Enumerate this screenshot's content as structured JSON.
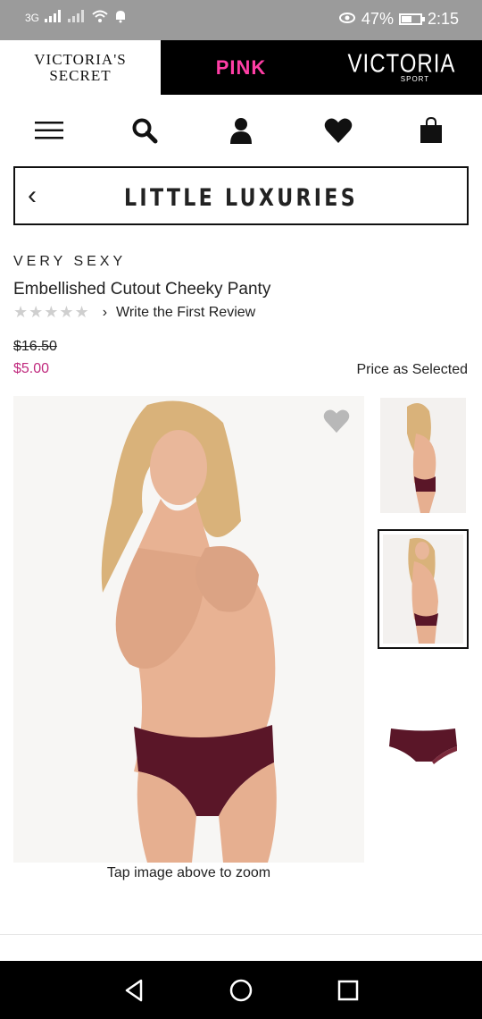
{
  "status_bar": {
    "network": "3G",
    "battery_percent": "47%",
    "time": "2:15"
  },
  "brands": {
    "vs_line1": "VICTORIA'S",
    "vs_line2": "SECRET",
    "pink": "PINK",
    "sport_main": "VICTORIA",
    "sport_sub": "SPORT"
  },
  "header_icons": [
    "menu-icon",
    "search-icon",
    "account-icon",
    "heart-icon",
    "bag-icon"
  ],
  "category": {
    "back": "‹",
    "title": "LITTLE LUXURIES"
  },
  "product": {
    "collection": "VERY SEXY",
    "name": "Embellished Cutout Cheeky Panty",
    "stars": "★★★★★",
    "review_chevron": "›",
    "review_link": "Write the First Review",
    "original_price": "$16.50",
    "sale_price": "$5.00",
    "price_note": "Price as Selected"
  },
  "gallery": {
    "zoom_hint": "Tap image above to zoom"
  },
  "colors": {
    "brand_pink": "#ff3ea5",
    "sale_price": "#c02a7e",
    "status_bar": "#9b9b9b",
    "panty": "#5a1628"
  }
}
